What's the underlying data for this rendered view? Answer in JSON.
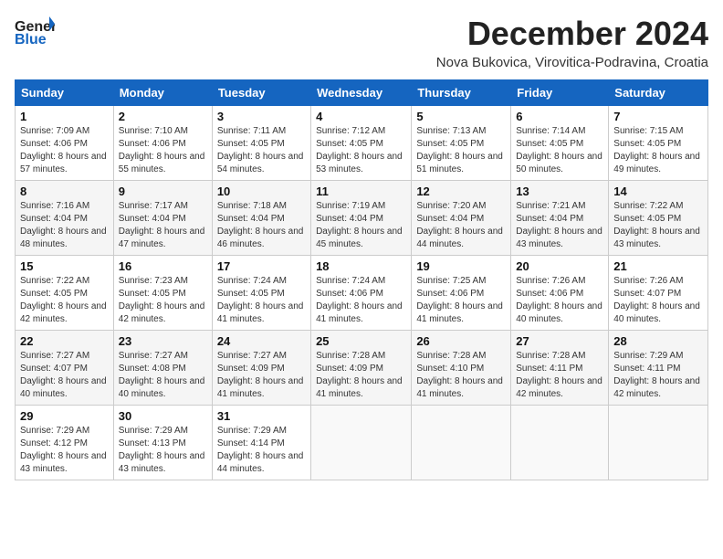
{
  "logo": {
    "general": "General",
    "blue": "Blue"
  },
  "title": "December 2024",
  "location": "Nova Bukovica, Virovitica-Podravina, Croatia",
  "days_header": [
    "Sunday",
    "Monday",
    "Tuesday",
    "Wednesday",
    "Thursday",
    "Friday",
    "Saturday"
  ],
  "weeks": [
    [
      {
        "day": "1",
        "sunrise": "7:09 AM",
        "sunset": "4:06 PM",
        "daylight": "8 hours and 57 minutes."
      },
      {
        "day": "2",
        "sunrise": "7:10 AM",
        "sunset": "4:06 PM",
        "daylight": "8 hours and 55 minutes."
      },
      {
        "day": "3",
        "sunrise": "7:11 AM",
        "sunset": "4:05 PM",
        "daylight": "8 hours and 54 minutes."
      },
      {
        "day": "4",
        "sunrise": "7:12 AM",
        "sunset": "4:05 PM",
        "daylight": "8 hours and 53 minutes."
      },
      {
        "day": "5",
        "sunrise": "7:13 AM",
        "sunset": "4:05 PM",
        "daylight": "8 hours and 51 minutes."
      },
      {
        "day": "6",
        "sunrise": "7:14 AM",
        "sunset": "4:05 PM",
        "daylight": "8 hours and 50 minutes."
      },
      {
        "day": "7",
        "sunrise": "7:15 AM",
        "sunset": "4:05 PM",
        "daylight": "8 hours and 49 minutes."
      }
    ],
    [
      {
        "day": "8",
        "sunrise": "7:16 AM",
        "sunset": "4:04 PM",
        "daylight": "8 hours and 48 minutes."
      },
      {
        "day": "9",
        "sunrise": "7:17 AM",
        "sunset": "4:04 PM",
        "daylight": "8 hours and 47 minutes."
      },
      {
        "day": "10",
        "sunrise": "7:18 AM",
        "sunset": "4:04 PM",
        "daylight": "8 hours and 46 minutes."
      },
      {
        "day": "11",
        "sunrise": "7:19 AM",
        "sunset": "4:04 PM",
        "daylight": "8 hours and 45 minutes."
      },
      {
        "day": "12",
        "sunrise": "7:20 AM",
        "sunset": "4:04 PM",
        "daylight": "8 hours and 44 minutes."
      },
      {
        "day": "13",
        "sunrise": "7:21 AM",
        "sunset": "4:04 PM",
        "daylight": "8 hours and 43 minutes."
      },
      {
        "day": "14",
        "sunrise": "7:22 AM",
        "sunset": "4:05 PM",
        "daylight": "8 hours and 43 minutes."
      }
    ],
    [
      {
        "day": "15",
        "sunrise": "7:22 AM",
        "sunset": "4:05 PM",
        "daylight": "8 hours and 42 minutes."
      },
      {
        "day": "16",
        "sunrise": "7:23 AM",
        "sunset": "4:05 PM",
        "daylight": "8 hours and 42 minutes."
      },
      {
        "day": "17",
        "sunrise": "7:24 AM",
        "sunset": "4:05 PM",
        "daylight": "8 hours and 41 minutes."
      },
      {
        "day": "18",
        "sunrise": "7:24 AM",
        "sunset": "4:06 PM",
        "daylight": "8 hours and 41 minutes."
      },
      {
        "day": "19",
        "sunrise": "7:25 AM",
        "sunset": "4:06 PM",
        "daylight": "8 hours and 41 minutes."
      },
      {
        "day": "20",
        "sunrise": "7:26 AM",
        "sunset": "4:06 PM",
        "daylight": "8 hours and 40 minutes."
      },
      {
        "day": "21",
        "sunrise": "7:26 AM",
        "sunset": "4:07 PM",
        "daylight": "8 hours and 40 minutes."
      }
    ],
    [
      {
        "day": "22",
        "sunrise": "7:27 AM",
        "sunset": "4:07 PM",
        "daylight": "8 hours and 40 minutes."
      },
      {
        "day": "23",
        "sunrise": "7:27 AM",
        "sunset": "4:08 PM",
        "daylight": "8 hours and 40 minutes."
      },
      {
        "day": "24",
        "sunrise": "7:27 AM",
        "sunset": "4:09 PM",
        "daylight": "8 hours and 41 minutes."
      },
      {
        "day": "25",
        "sunrise": "7:28 AM",
        "sunset": "4:09 PM",
        "daylight": "8 hours and 41 minutes."
      },
      {
        "day": "26",
        "sunrise": "7:28 AM",
        "sunset": "4:10 PM",
        "daylight": "8 hours and 41 minutes."
      },
      {
        "day": "27",
        "sunrise": "7:28 AM",
        "sunset": "4:11 PM",
        "daylight": "8 hours and 42 minutes."
      },
      {
        "day": "28",
        "sunrise": "7:29 AM",
        "sunset": "4:11 PM",
        "daylight": "8 hours and 42 minutes."
      }
    ],
    [
      {
        "day": "29",
        "sunrise": "7:29 AM",
        "sunset": "4:12 PM",
        "daylight": "8 hours and 43 minutes."
      },
      {
        "day": "30",
        "sunrise": "7:29 AM",
        "sunset": "4:13 PM",
        "daylight": "8 hours and 43 minutes."
      },
      {
        "day": "31",
        "sunrise": "7:29 AM",
        "sunset": "4:14 PM",
        "daylight": "8 hours and 44 minutes."
      },
      null,
      null,
      null,
      null
    ]
  ]
}
